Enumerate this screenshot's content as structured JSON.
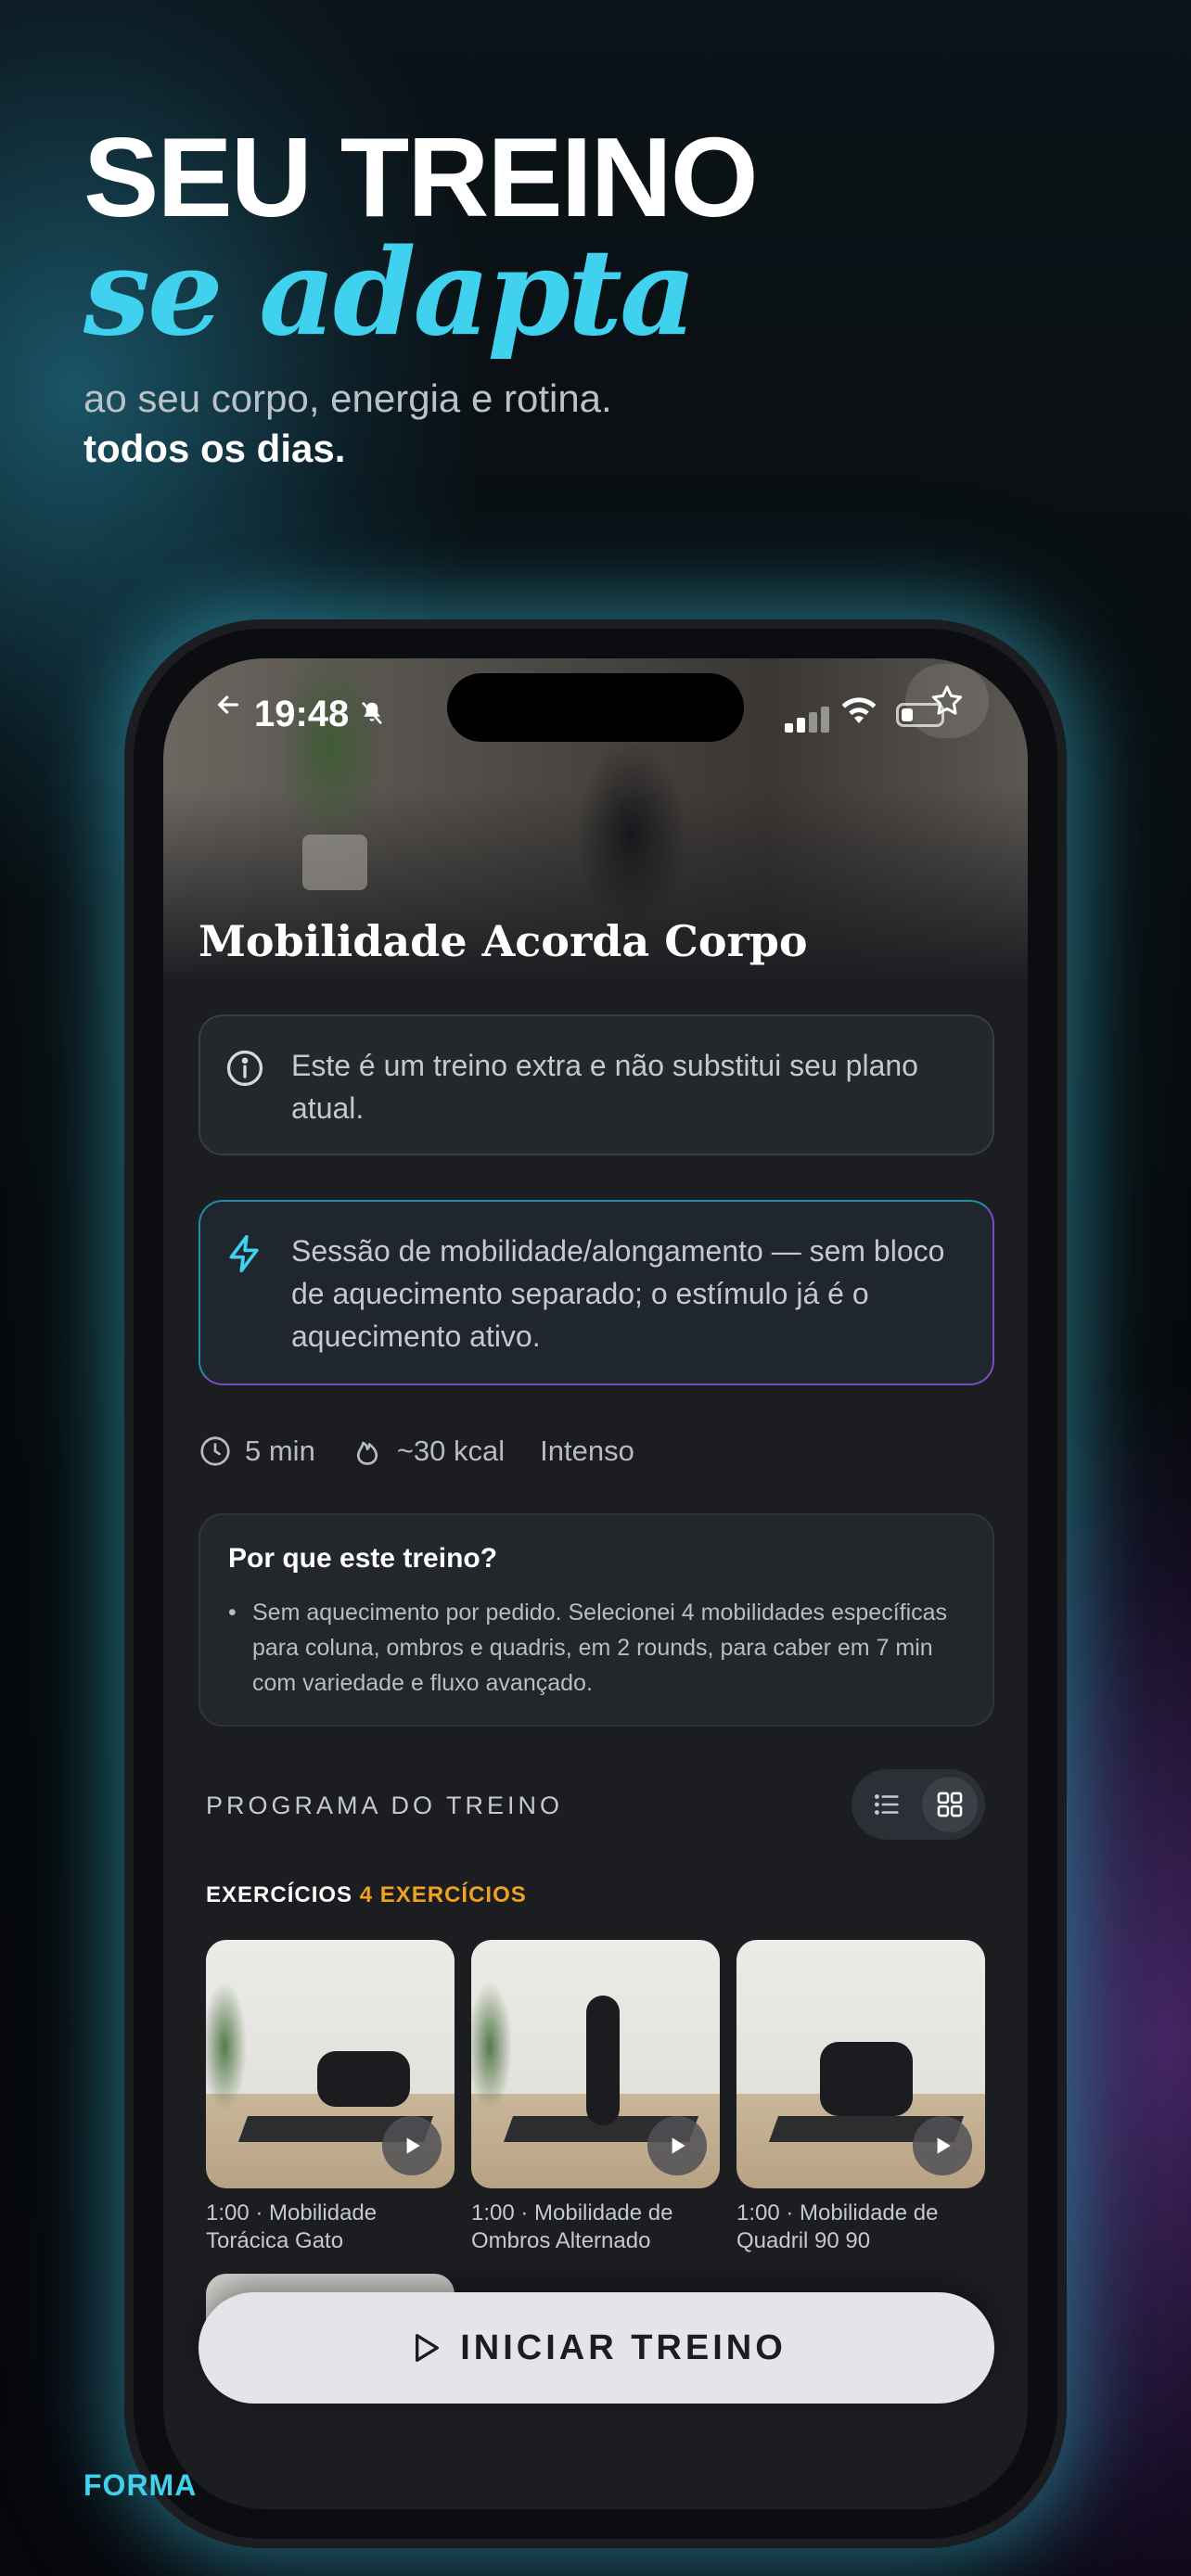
{
  "headline": {
    "line1": "SEU TREINO",
    "line2": "se adapta",
    "sub1": "ao seu corpo, energia e rotina.",
    "sub2": "todos os dias."
  },
  "brand": "FORMA",
  "status_bar": {
    "time": "19:48"
  },
  "workout": {
    "title": "Mobilidade Acorda Corpo",
    "info_notice": "Este é um treino extra e não substitui seu plano atual.",
    "tip_notice": "Sessão de mobilidade/alongamento — sem bloco de aquecimento separado; o estímulo já é o aquecimento ativo.",
    "meta": {
      "duration": "5 min",
      "calories": "~30 kcal",
      "intensity": "Intenso"
    },
    "why": {
      "title": "Por que este treino?",
      "bullets": [
        "Sem aquecimento por pedido. Selecionei 4 mobilidades específicas para coluna, ombros e quadris, em 2 rounds, para caber em 7 min com variedade e fluxo avançado."
      ]
    },
    "program_label": "PROGRAMA DO TREINO",
    "exercises_label": "EXERCÍCIOS",
    "exercises_count": "4 EXERCÍCIOS",
    "exercises": [
      {
        "caption": "1:00 · Mobilidade Torácica Gato"
      },
      {
        "caption": "1:00 · Mobilidade de Ombros Alternado"
      },
      {
        "caption": "1:00 · Mobilidade de Quadril 90 90"
      }
    ],
    "cta_label": "INICIAR TREINO"
  },
  "colors": {
    "accent": "#3fd1ee",
    "count": "#f0a21f",
    "cta_bg": "#e4e5e8"
  }
}
